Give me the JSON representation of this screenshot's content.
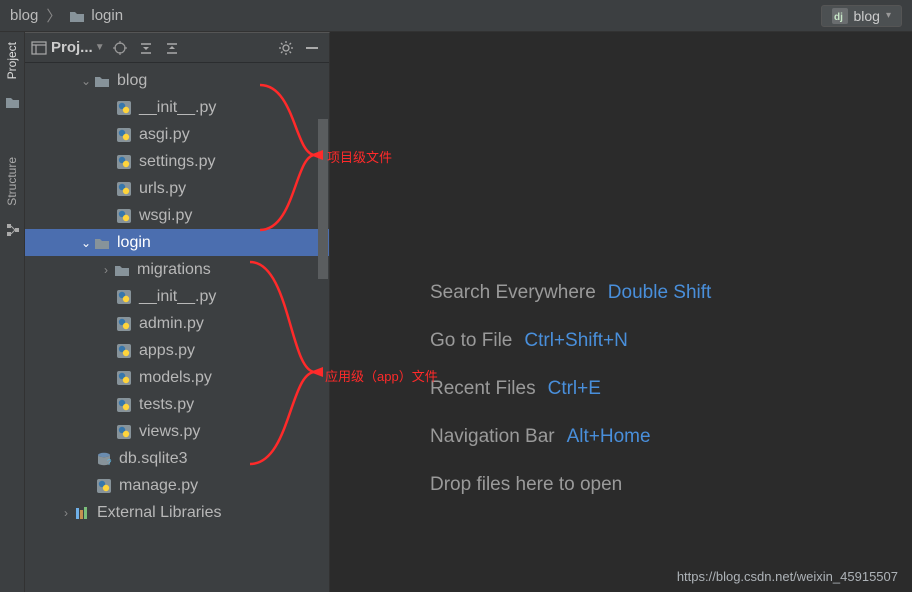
{
  "breadcrumb": {
    "root": "blog",
    "child": "login"
  },
  "run_config": {
    "label": "blog"
  },
  "left_tabs": {
    "project": "Project",
    "structure": "Structure"
  },
  "panel": {
    "title": "Proj..."
  },
  "tree": {
    "blog_folder": "blog",
    "blog_files": {
      "init": "__init__.py",
      "asgi": "asgi.py",
      "settings": "settings.py",
      "urls": "urls.py",
      "wsgi": "wsgi.py"
    },
    "login_folder": "login",
    "migrations": "migrations",
    "login_files": {
      "init": "__init__.py",
      "admin": "admin.py",
      "apps": "apps.py",
      "models": "models.py",
      "tests": "tests.py",
      "views": "views.py"
    },
    "db": "db.sqlite3",
    "manage": "manage.py",
    "ext_libs": "External Libraries"
  },
  "welcome": {
    "search_label": "Search Everywhere",
    "search_key": "Double Shift",
    "goto_label": "Go to File",
    "goto_key": "Ctrl+Shift+N",
    "recent_label": "Recent Files",
    "recent_key": "Ctrl+E",
    "nav_label": "Navigation Bar",
    "nav_key": "Alt+Home",
    "drop": "Drop files here to open"
  },
  "annotations": {
    "project_level": "项目级文件",
    "app_level": "应用级（app）文件"
  },
  "watermark": "https://blog.csdn.net/weixin_45915507"
}
